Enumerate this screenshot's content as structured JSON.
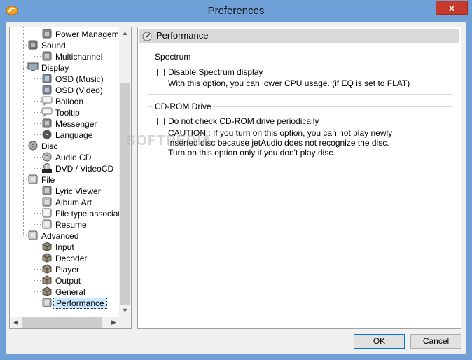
{
  "window": {
    "title": "Preferences",
    "close_glyph": "✕"
  },
  "tree": {
    "items": [
      {
        "label": "Power Management",
        "icon": "power-icon",
        "level": 2
      },
      {
        "label": "Sound",
        "icon": "speaker-icon",
        "level": 1
      },
      {
        "label": "Multichannel",
        "icon": "multichannel-icon",
        "level": 2
      },
      {
        "label": "Display",
        "icon": "monitor-icon",
        "level": 1
      },
      {
        "label": "OSD (Music)",
        "icon": "osd-music-icon",
        "level": 2
      },
      {
        "label": "OSD (Video)",
        "icon": "osd-video-icon",
        "level": 2
      },
      {
        "label": "Balloon",
        "icon": "balloon-icon",
        "level": 2
      },
      {
        "label": "Tooltip",
        "icon": "tooltip-icon",
        "level": 2
      },
      {
        "label": "Messenger",
        "icon": "messenger-icon",
        "level": 2
      },
      {
        "label": "Language",
        "icon": "globe-icon",
        "level": 2
      },
      {
        "label": "Disc",
        "icon": "disc-icon",
        "level": 1
      },
      {
        "label": "Audio CD",
        "icon": "cd-icon",
        "level": 2
      },
      {
        "label": "DVD / VideoCD",
        "icon": "dvd-icon",
        "level": 2
      },
      {
        "label": "File",
        "icon": "file-icon",
        "level": 1
      },
      {
        "label": "Lyric Viewer",
        "icon": "lyric-icon",
        "level": 2
      },
      {
        "label": "Album Art",
        "icon": "album-art-icon",
        "level": 2
      },
      {
        "label": "File type association",
        "icon": "file-type-icon",
        "level": 2
      },
      {
        "label": "Resume",
        "icon": "resume-icon",
        "level": 2
      },
      {
        "label": "Advanced",
        "icon": "advanced-folder-icon",
        "level": 1
      },
      {
        "label": "Input",
        "icon": "cube-icon",
        "level": 2
      },
      {
        "label": "Decoder",
        "icon": "cube-icon",
        "level": 2
      },
      {
        "label": "Player",
        "icon": "cube-icon",
        "level": 2
      },
      {
        "label": "Output",
        "icon": "cube-icon",
        "level": 2
      },
      {
        "label": "General",
        "icon": "cube-icon",
        "level": 2
      },
      {
        "label": "Performance",
        "icon": "performance-icon",
        "level": 2,
        "selected": true
      }
    ]
  },
  "panel": {
    "title": "Performance",
    "spectrum": {
      "group_title": "Spectrum",
      "checkbox_label": "Disable Spectrum display",
      "checked": false,
      "description": "With this option, you can lower CPU usage. (if EQ is set to FLAT)"
    },
    "cdrom": {
      "group_title": "CD-ROM Drive",
      "checkbox_label": "Do not check CD-ROM drive periodically",
      "checked": false,
      "caution_1": "CAUTION : If you turn on this option, you can not play newly",
      "caution_2": "inserted disc because jetAudio does not recognize the disc.",
      "caution_3": "Turn on this option only if you don't play disc."
    }
  },
  "watermark": "SOFTPEDIA",
  "buttons": {
    "ok": "OK",
    "cancel": "Cancel"
  },
  "colors": {
    "titlebar": "#6fa1d8",
    "close": "#c7392c",
    "selection": "#cce8ff"
  }
}
